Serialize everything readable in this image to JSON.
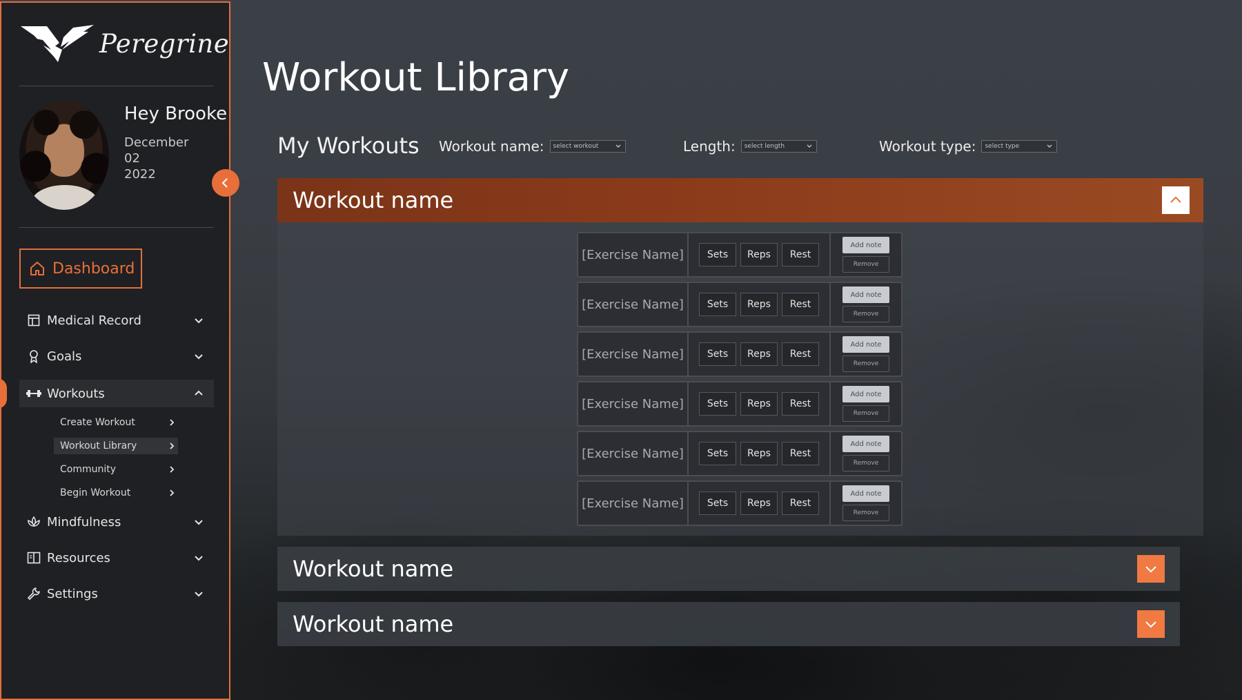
{
  "colors": {
    "accent": "#e96f3a",
    "header_bar": "#8a3a1a",
    "sidebar_bg": "#1f2023"
  },
  "brand": {
    "name": "Peregrine",
    "logo_icon": "peregrine-wing-logo"
  },
  "user": {
    "greeting": "Hey Brooke",
    "date_month": "December",
    "date_day": "02",
    "date_year": "2022"
  },
  "sidebar": {
    "dashboard_label": "Dashboard",
    "items": [
      {
        "label": "Medical Record",
        "icon": "medical-record-icon"
      },
      {
        "label": "Goals",
        "icon": "goals-icon"
      },
      {
        "label": "Workouts",
        "icon": "dumbbell-icon",
        "expanded": true
      },
      {
        "label": "Mindfulness",
        "icon": "lotus-icon"
      },
      {
        "label": "Resources",
        "icon": "book-icon"
      },
      {
        "label": "Settings",
        "icon": "wrench-icon"
      }
    ],
    "sub_items": [
      {
        "label": "Create Workout"
      },
      {
        "label": "Workout Library",
        "active": true
      },
      {
        "label": "Community"
      },
      {
        "label": "Begin Workout"
      }
    ]
  },
  "main": {
    "page_title": "Workout Library",
    "section_title": "My Workouts",
    "filters": [
      {
        "label": "Workout name:",
        "placeholder": "select workout"
      },
      {
        "label": "Length:",
        "placeholder": "select length"
      },
      {
        "label": "Workout type:",
        "placeholder": "select type"
      }
    ],
    "workouts": [
      {
        "name": "Workout name",
        "expanded": true
      },
      {
        "name": "Workout name",
        "expanded": false
      },
      {
        "name": "Workout name",
        "expanded": false
      }
    ],
    "exercise_row": {
      "name": "[Exercise Name]",
      "sets": "Sets",
      "reps": "Reps",
      "rest": "Rest",
      "add_note": "Add note",
      "remove": "Remove"
    },
    "exercise_count": 6
  }
}
